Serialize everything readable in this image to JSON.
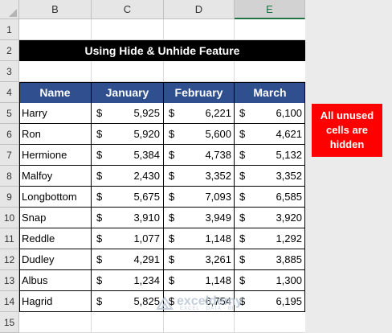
{
  "columns": [
    "B",
    "C",
    "D",
    "E"
  ],
  "selected_column": "E",
  "rows": [
    "1",
    "2",
    "3",
    "4",
    "5",
    "6",
    "7",
    "8",
    "9",
    "10",
    "11",
    "12",
    "13",
    "14",
    "15"
  ],
  "title": "Using Hide & Unhide Feature",
  "table": {
    "headers": [
      "Name",
      "January",
      "February",
      "March"
    ],
    "currency_symbol": "$",
    "records": [
      {
        "name": "Harry",
        "jan": "5,925",
        "feb": "6,221",
        "mar": "6,100"
      },
      {
        "name": "Ron",
        "jan": "5,920",
        "feb": "5,600",
        "mar": "4,621"
      },
      {
        "name": "Hermione",
        "jan": "5,384",
        "feb": "4,738",
        "mar": "5,132"
      },
      {
        "name": "Malfoy",
        "jan": "2,430",
        "feb": "3,352",
        "mar": "3,352"
      },
      {
        "name": "Longbottom",
        "jan": "5,675",
        "feb": "7,093",
        "mar": "6,585"
      },
      {
        "name": "Snap",
        "jan": "3,910",
        "feb": "3,949",
        "mar": "3,920"
      },
      {
        "name": "Reddle",
        "jan": "1,077",
        "feb": "1,148",
        "mar": "1,292"
      },
      {
        "name": "Dudley",
        "jan": "4,291",
        "feb": "3,261",
        "mar": "3,885"
      },
      {
        "name": "Albus",
        "jan": "1,234",
        "feb": "1,148",
        "mar": "1,300"
      },
      {
        "name": "Hagrid",
        "jan": "5,825",
        "feb": "6,754",
        "mar": "6,195"
      }
    ]
  },
  "note": "All unused cells are hidden",
  "watermark": {
    "brand": "exceldemy",
    "tagline": "EXCEL · DATA · BI"
  },
  "colors": {
    "header_fill": "#2f4f8f",
    "title_fill": "#000000",
    "note_fill": "#ff0000"
  }
}
